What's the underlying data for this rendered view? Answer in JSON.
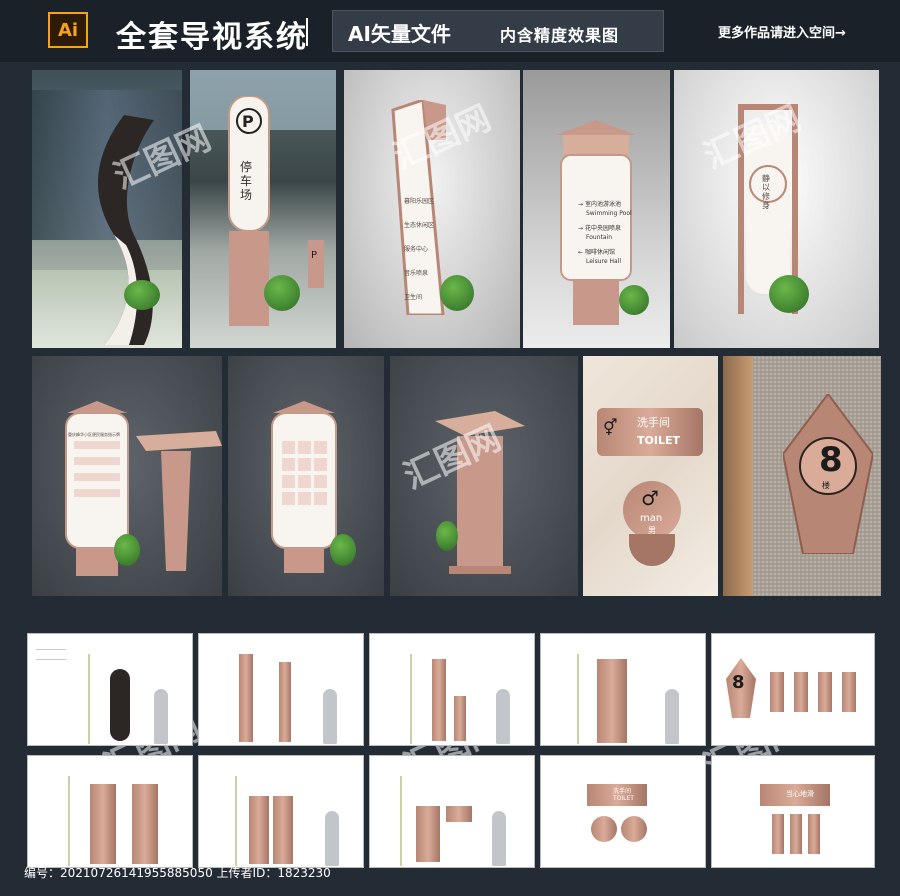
{
  "header": {
    "logo_text": "Ai",
    "title": "全套导视系统",
    "subtitle_main": "AI矢量文件",
    "subtitle_sub": "内含精度效果图",
    "more_link": "更多作品请进入空间→"
  },
  "signs": {
    "parking_letter": "P",
    "parking_text": "停车场",
    "small_p": "P",
    "toilet_cn": "洗手间",
    "toilet_en": "TOILET",
    "man_en": "man",
    "man_cn": "男",
    "floor_number": "8",
    "floor_suffix": "楼",
    "direction_items": [
      {
        "cn": "室内池游泳池",
        "en": "Swimming Pool"
      },
      {
        "cn": "花中央园喷泉",
        "en": "Fountain"
      },
      {
        "cn": "咖啡休闲馆",
        "en": "Leisure Hall"
      }
    ],
    "tall_sign_items": [
      "暮阳乐园区",
      "生态休闲区",
      "服务中心",
      "音乐喷泉",
      "卫生间"
    ],
    "board_heading": "重庆峰华小区便民服务指示牌",
    "side_banner": "静以修身",
    "sheet_sign_text": "洗手间",
    "sheet_sign_en": "TOILET",
    "sheet_floor_number": "8",
    "sheet_title_sign": "当心地滑"
  },
  "watermark": "汇图网",
  "footer": {
    "id_label": "编号：",
    "id_value": "20210726141955885050",
    "uploader_label": "上传者ID：",
    "uploader_value": "1823230"
  }
}
